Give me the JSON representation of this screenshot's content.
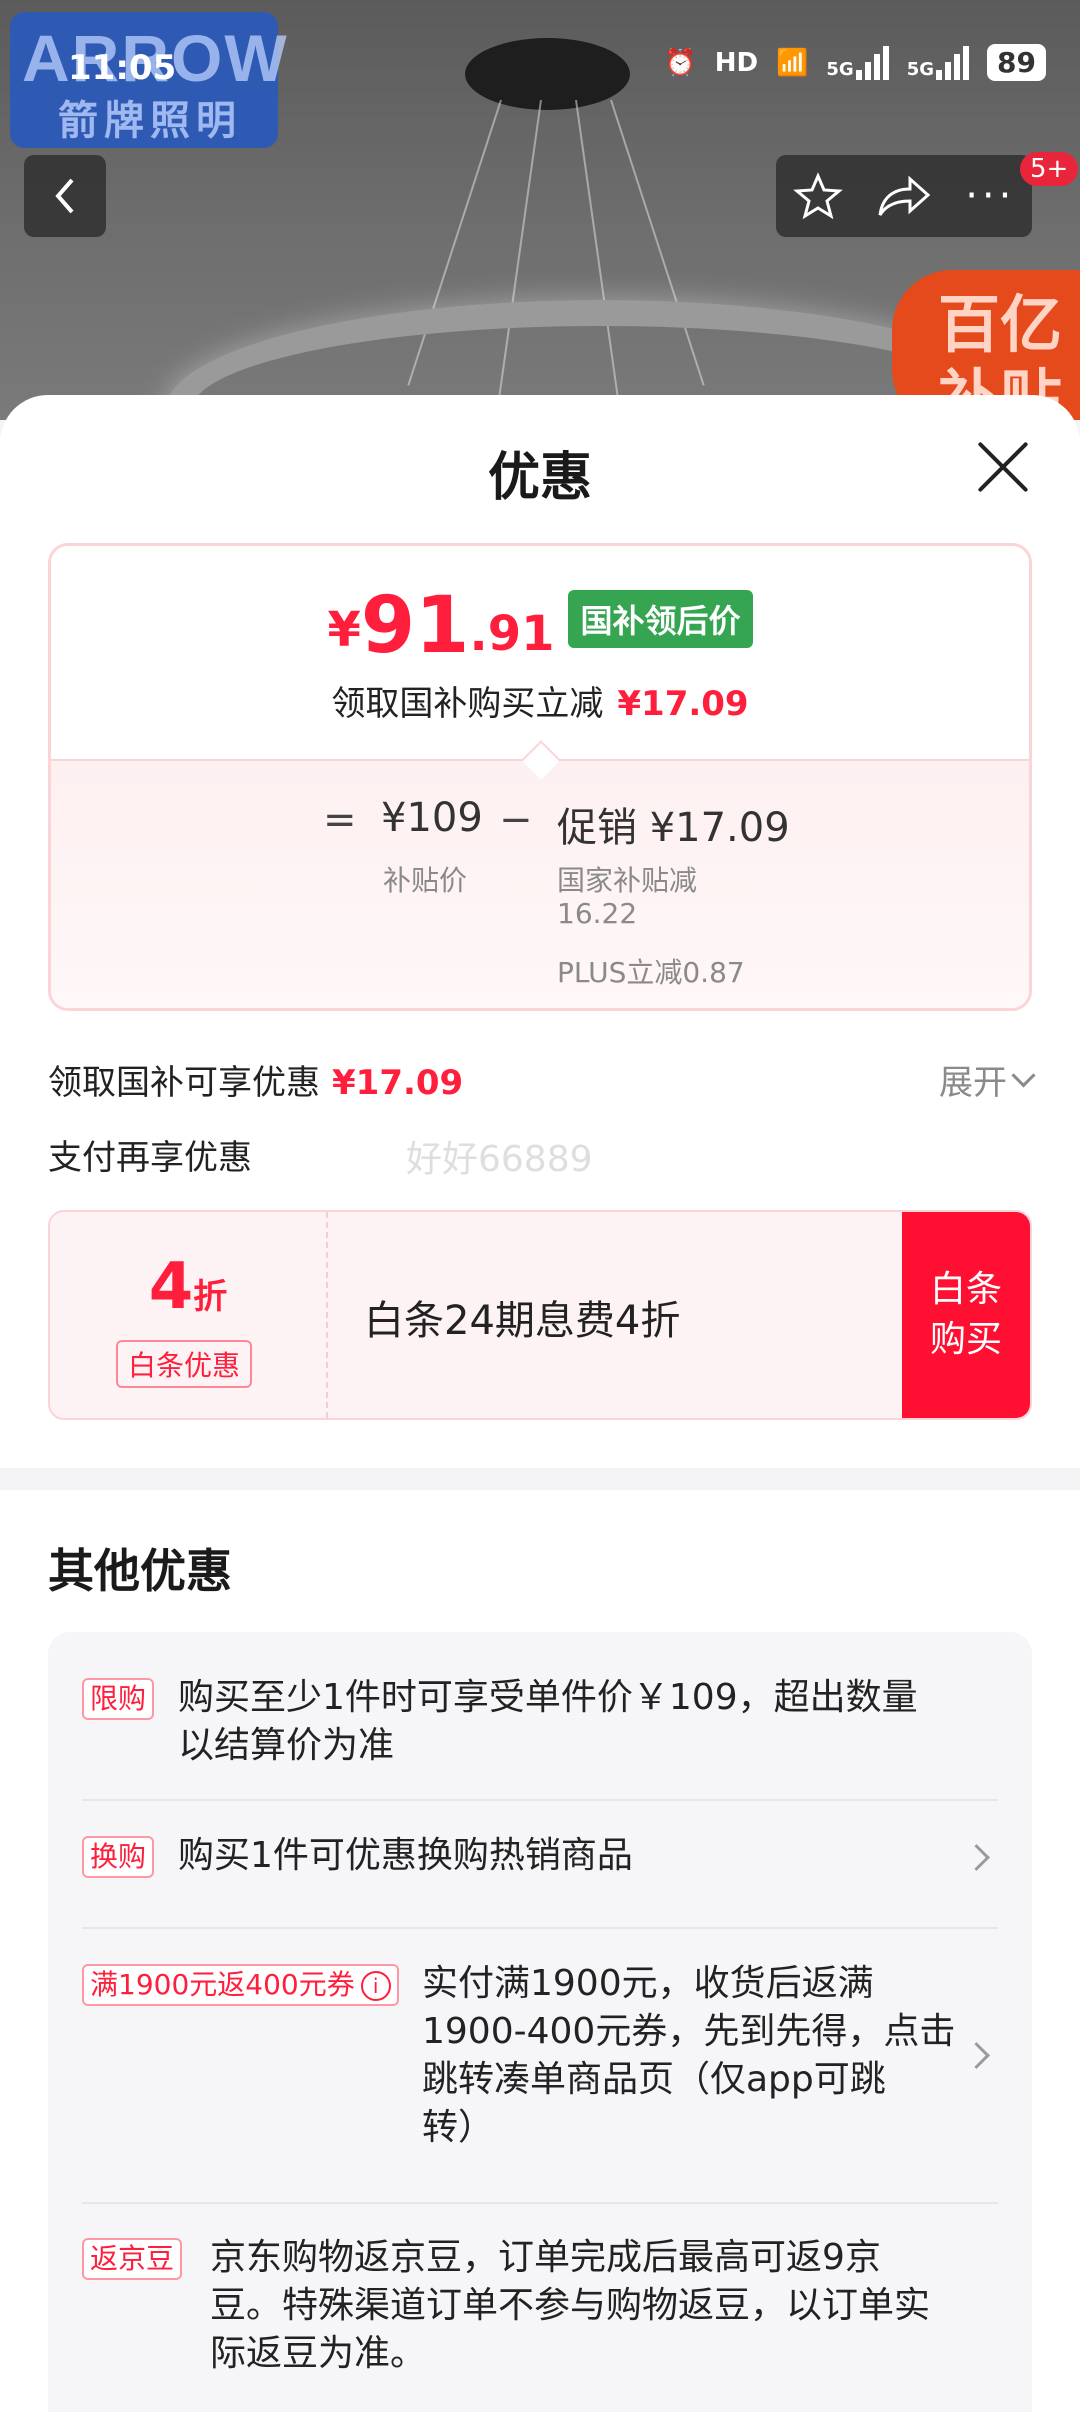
{
  "status": {
    "time": "11:05",
    "battery": "89",
    "net1": "5G",
    "net2": "5G",
    "hd": "HD"
  },
  "brand": {
    "en": "ARROW",
    "cn": "箭牌照明"
  },
  "header": {
    "cart_badge": "5+",
    "subsidy_tag": "百亿补贴"
  },
  "sheet": {
    "title": "优惠"
  },
  "price": {
    "currency": "¥",
    "integer": "91",
    "decimal": ".91",
    "badge": "国补领后价",
    "sub_text": "领取国补购买立减",
    "sub_amount": "¥17.09",
    "eq": "=",
    "minus": "−",
    "base_value": "¥109",
    "base_label": "补贴价",
    "promo_value": "促销 ¥17.09",
    "promo_line1": "国家补贴减",
    "promo_line2": "16.22",
    "promo_line3": "PLUS立减0.87"
  },
  "subsidy": {
    "label": "领取国补可享优惠",
    "amount": "¥17.09",
    "expand": "展开"
  },
  "pay": {
    "title": "支付再享优惠",
    "watermark": "好好66889"
  },
  "baitiao": {
    "discount_num": "4",
    "discount_unit": "折",
    "tag": "白条优惠",
    "desc": "白条24期息费4折",
    "btn_line1": "白条",
    "btn_line2": "购买"
  },
  "other": {
    "title": "其他优惠",
    "items": [
      {
        "tag": "限购",
        "text1": "购买至少1件时可享受单件价￥109，超出数量",
        "text2": "以结算价为准"
      },
      {
        "tag": "换购",
        "text1": "购买1件可优惠换购热销商品"
      },
      {
        "tag": "满1900元返400元券",
        "info": "i",
        "text1": "实付满1900元，收货后返满",
        "text2": "1900-400元券，先到先得，点击",
        "text3": "跳转凑单商品页（仅app可跳",
        "text4": "转）"
      },
      {
        "tag": "返京豆",
        "text1": "京东购物返京豆，订单完成后最高可返9京",
        "text2": "豆。特殊渠道订单不参与购物返豆，以订单实",
        "text3": "际返豆为准。"
      }
    ]
  }
}
